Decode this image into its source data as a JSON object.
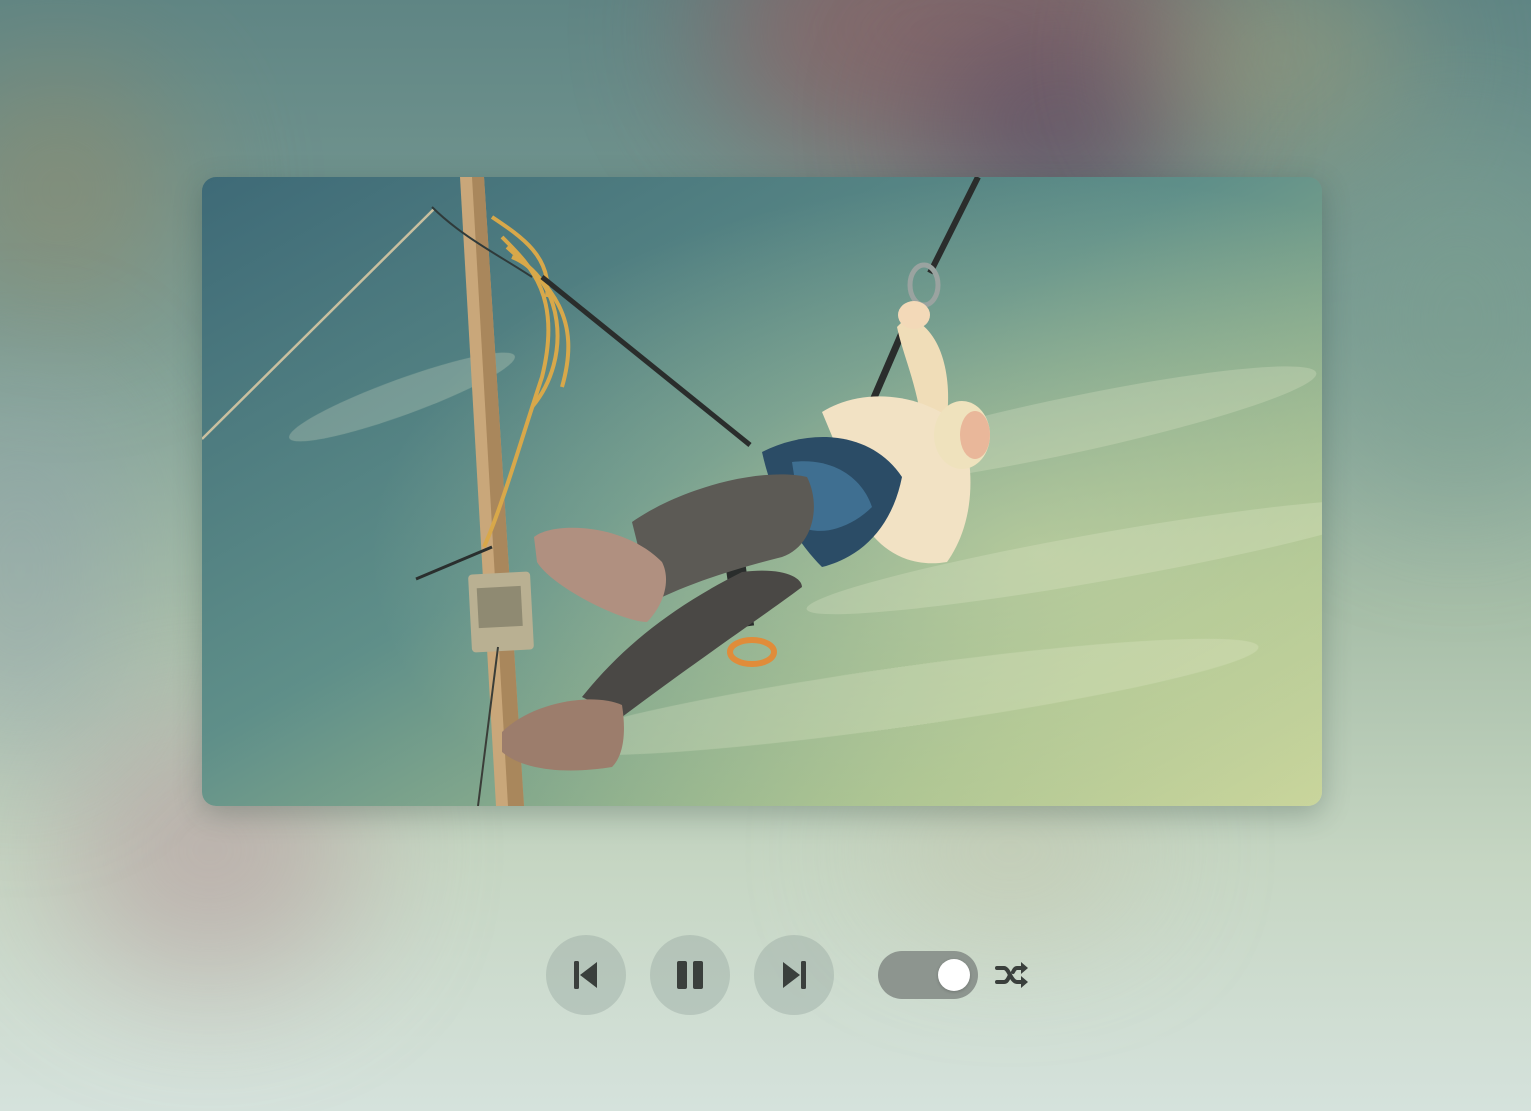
{
  "player": {
    "video_frame": "video-frame",
    "accent_toggle_color": "#8d958f",
    "icon_color": "#3a3f3c"
  },
  "controls": {
    "previous": {
      "icon": "skip-previous-icon"
    },
    "pause": {
      "icon": "pause-icon"
    },
    "next": {
      "icon": "skip-next-icon"
    },
    "shuffle_toggle": {
      "state": "on",
      "icon": "shuffle-icon"
    }
  }
}
